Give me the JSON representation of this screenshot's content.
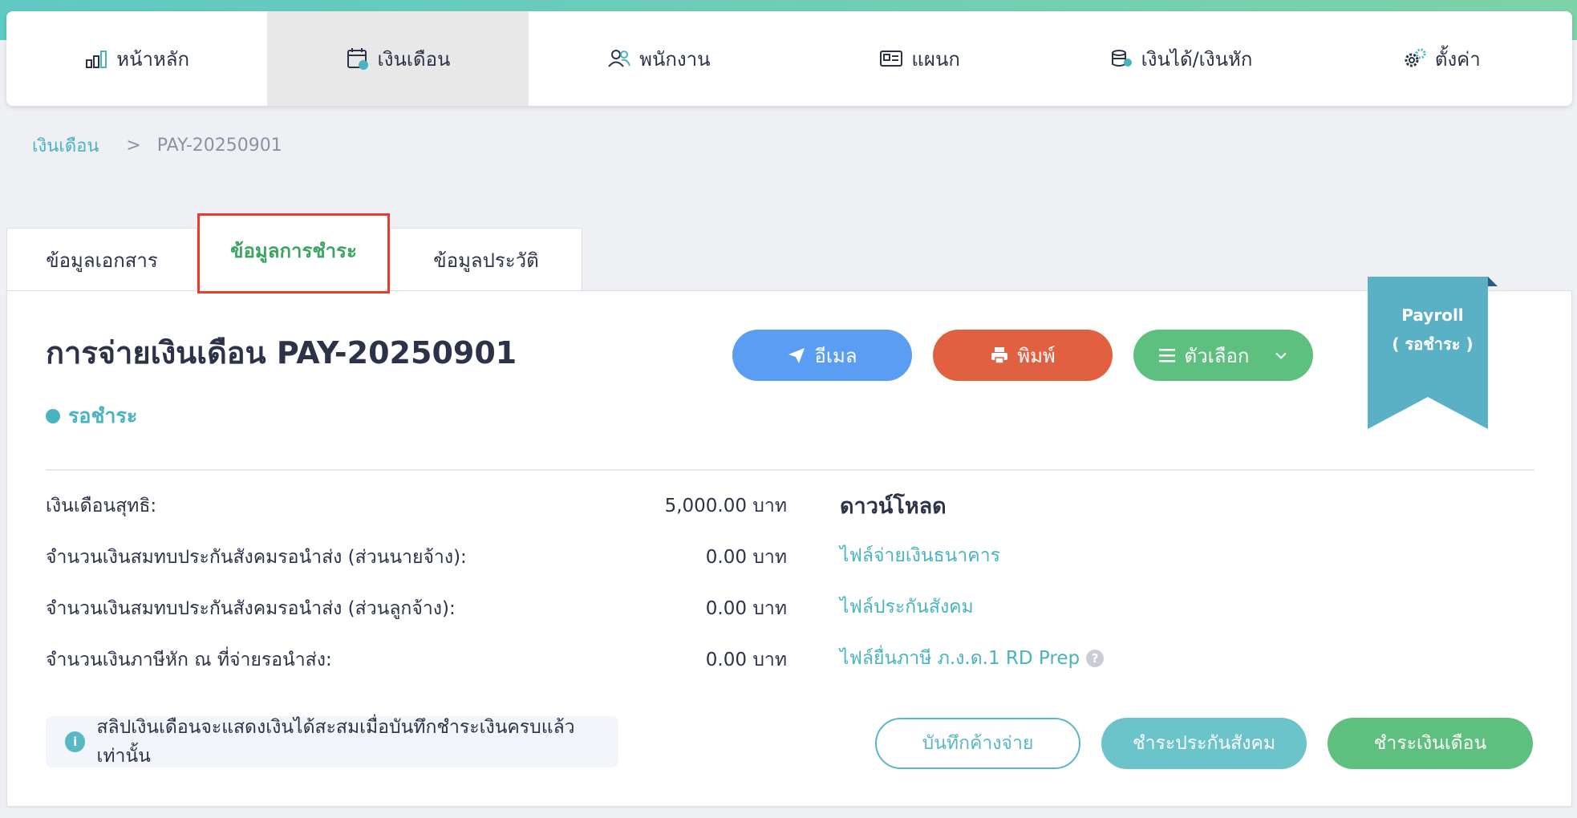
{
  "nav": {
    "items": [
      {
        "label": "หน้าหลัก",
        "icon": "chart-bar-icon"
      },
      {
        "label": "เงินเดือน",
        "icon": "calendar-icon",
        "active": true
      },
      {
        "label": "พนักงาน",
        "icon": "users-icon"
      },
      {
        "label": "แผนก",
        "icon": "id-card-icon"
      },
      {
        "label": "เงินได้/เงินหัก",
        "icon": "coins-icon"
      },
      {
        "label": "ตั้งค่า",
        "icon": "gears-icon"
      }
    ]
  },
  "breadcrumb": {
    "parent": "เงินเดือน",
    "separator": ">",
    "current": "PAY-20250901"
  },
  "tabs": [
    {
      "label": "ข้อมูลเอกสาร"
    },
    {
      "label": "ข้อมูลการชำระ",
      "active": true
    },
    {
      "label": "ข้อมูลประวัติ"
    }
  ],
  "header": {
    "title": "การจ่ายเงินเดือน PAY-20250901",
    "status": "รอชำระ"
  },
  "actions": {
    "email": "อีเมล",
    "print": "พิมพ์",
    "options": "ตัวเลือก"
  },
  "ribbon": {
    "line1": "Payroll",
    "line2": "( รอชำระ )"
  },
  "summary": [
    {
      "label": "เงินเดือนสุทธิ:",
      "value": "5,000.00 บาท"
    },
    {
      "label": "จำนวนเงินสมทบประกันสังคมรอนำส่ง (ส่วนนายจ้าง):",
      "value": "0.00 บาท"
    },
    {
      "label": "จำนวนเงินสมทบประกันสังคมรอนำส่ง (ส่วนลูกจ้าง):",
      "value": "0.00 บาท"
    },
    {
      "label": "จำนวนเงินภาษีหัก ณ ที่จ่ายรอนำส่ง:",
      "value": "0.00 บาท"
    }
  ],
  "downloads": {
    "title": "ดาวน์โหลด",
    "links": [
      "ไฟล์จ่ายเงินธนาคาร",
      "ไฟล์ประกันสังคม",
      "ไฟล์ยื่นภาษี ภ.ง.ด.1 RD Prep"
    ]
  },
  "info": {
    "text": "สลิปเงินเดือนจะแสดงเงินได้สะสมเมื่อบันทึกชำระเงินครบแล้วเท่านั้น"
  },
  "footer_buttons": {
    "record_unpaid": "บันทึกค้างจ่าย",
    "pay_social": "ชำระประกันสังคม",
    "pay_salary": "ชำระเงินเดือน"
  },
  "colors": {
    "accent_teal": "#4ab3c0",
    "accent_green": "#5ec07e",
    "accent_blue": "#5b9df3",
    "accent_red": "#e26042",
    "ribbon": "#5ab0c4"
  }
}
